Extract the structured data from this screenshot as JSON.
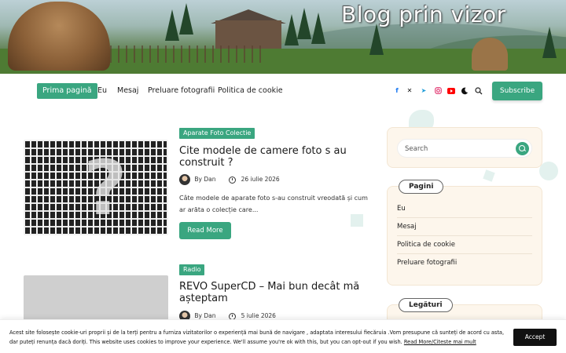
{
  "header": {
    "blog_title": "Blog prin vizor"
  },
  "nav": {
    "items": [
      {
        "label": "Prima pagină",
        "active": true
      },
      {
        "label": "Eu",
        "active": false
      },
      {
        "label": "Mesaj",
        "active": false
      },
      {
        "label": "Preluare fotografii",
        "active": false
      },
      {
        "label": "Politica de cookie",
        "active": false
      }
    ],
    "social_icons": [
      "facebook-icon",
      "x-icon",
      "telegram-icon",
      "instagram-icon",
      "youtube-icon",
      "dark-mode-icon",
      "search-icon"
    ],
    "subscribe_label": "Subscribe"
  },
  "posts": [
    {
      "category": "Aparate Foto Colectie",
      "title": "Cite modele de camere foto s au construit ?",
      "author": "By Dan",
      "date": "26 iulie 2026",
      "excerpt": "Câte modele de aparate foto s-au construit vreodată și cum ar arăta o colecție care...",
      "read_more": "Read More"
    },
    {
      "category": "Radio",
      "title": "REVO SuperCD – Mai bun decât mă așteptam",
      "author": "By Dan",
      "date": "5 iulie 2026"
    }
  ],
  "sidebar": {
    "search_placeholder": "Search",
    "pages_heading": "Pagini",
    "pages": [
      "Eu",
      "Mesaj",
      "Politica de cookie",
      "Preluare fotografii"
    ],
    "links_heading": "Legături"
  },
  "cookie": {
    "text": "Acest site folosește cookie-uri proprii și de la terți pentru a furniza vizitatorilor o experiență mai bună de navigare , adaptata interesului fiecăruia .Vom presupune că sunteți de acord cu asta, dar puteți renunța dacă doriți. This website uses cookies to improve your experience. We'll assume you're ok with this, but you can opt-out if you wish.",
    "link": "Read More/Citeste mai mult",
    "accept": "Accept"
  },
  "colors": {
    "accent": "#3aa680",
    "widget_bg": "#fdf6ec"
  }
}
